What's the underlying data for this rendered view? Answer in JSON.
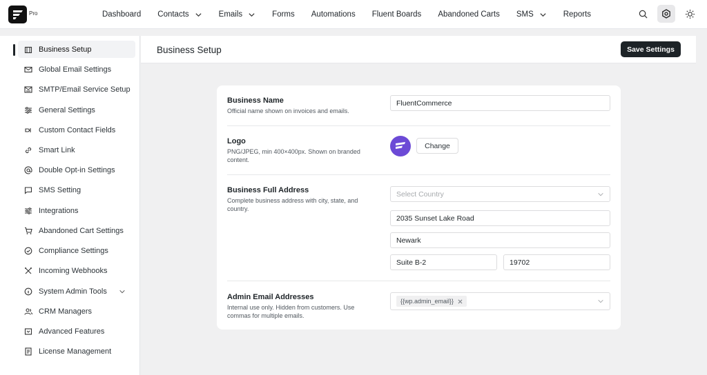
{
  "brand": {
    "pro_label": "Pro"
  },
  "nav": {
    "items": [
      {
        "label": "Dashboard",
        "dropdown": false
      },
      {
        "label": "Contacts",
        "dropdown": true
      },
      {
        "label": "Emails",
        "dropdown": true
      },
      {
        "label": "Forms",
        "dropdown": false
      },
      {
        "label": "Automations",
        "dropdown": false
      },
      {
        "label": "Fluent Boards",
        "dropdown": false
      },
      {
        "label": "Abandoned Carts",
        "dropdown": false
      },
      {
        "label": "SMS",
        "dropdown": true
      },
      {
        "label": "Reports",
        "dropdown": false
      }
    ],
    "icons": [
      "search-icon",
      "settings-icon",
      "sun-icon"
    ]
  },
  "sidebar": {
    "items": [
      {
        "label": "Business Setup",
        "icon": "building-icon",
        "active": true
      },
      {
        "label": "Global Email Settings",
        "icon": "mail-settings-icon"
      },
      {
        "label": "SMTP/Email Service Setup",
        "icon": "mail-server-icon"
      },
      {
        "label": "General Settings",
        "icon": "sliders-icon"
      },
      {
        "label": "Custom Contact Fields",
        "icon": "fields-icon"
      },
      {
        "label": "Smart Link",
        "icon": "link-icon"
      },
      {
        "label": "Double Opt-in Settings",
        "icon": "at-icon"
      },
      {
        "label": "SMS Setting",
        "icon": "message-icon"
      },
      {
        "label": "Integrations",
        "icon": "integrations-icon"
      },
      {
        "label": "Abandoned Cart Settings",
        "icon": "cart-icon"
      },
      {
        "label": "Compliance Settings",
        "icon": "check-circle-icon"
      },
      {
        "label": "Incoming Webhooks",
        "icon": "webhook-icon"
      },
      {
        "label": "System Admin Tools",
        "icon": "info-icon",
        "expandable": true
      },
      {
        "label": "CRM Managers",
        "icon": "users-icon"
      },
      {
        "label": "Advanced Features",
        "icon": "features-icon"
      },
      {
        "label": "License Management",
        "icon": "license-icon"
      }
    ]
  },
  "header": {
    "title": "Business Setup",
    "save_label": "Save Settings"
  },
  "form": {
    "business_name": {
      "label": "Business Name",
      "description": "Official name shown on invoices and emails.",
      "value": "FluentCommerce"
    },
    "logo": {
      "label": "Logo",
      "description": "PNG/JPEG, min 400×400px. Shown on branded content.",
      "change_label": "Change"
    },
    "address": {
      "label": "Business Full Address",
      "description": "Complete business address with city, state, and country.",
      "country_placeholder": "Select Country",
      "street": "2035 Sunset Lake Road",
      "city": "Newark",
      "suite": "Suite B-2",
      "zip": "19702"
    },
    "admin_email": {
      "label": "Admin Email Addresses",
      "description": "Internal use only. Hidden from customers. Use commas for multiple emails.",
      "tag": "{{wp.admin_email}}"
    }
  },
  "colors": {
    "accent": "#1d2327",
    "logo_purple": "#6c4ad6"
  }
}
